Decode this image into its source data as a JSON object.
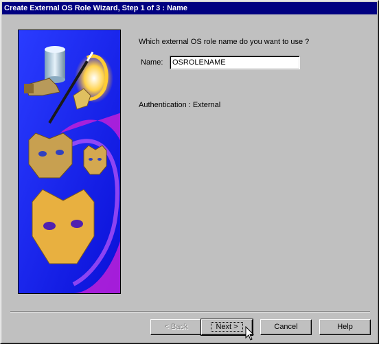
{
  "window": {
    "title": "Create External OS Role Wizard, Step 1 of 3 : Name"
  },
  "form": {
    "question": "Which external OS role name do you want to use ?",
    "name_label": "Name:",
    "name_value": "OSROLENAME",
    "authentication_text": "Authentication : External"
  },
  "buttons": {
    "back": "< Back",
    "next": "Next >",
    "cancel": "Cancel",
    "help": "Help"
  },
  "colors": {
    "titlebar": "#000080",
    "dialog_face": "#c0c0c0"
  }
}
